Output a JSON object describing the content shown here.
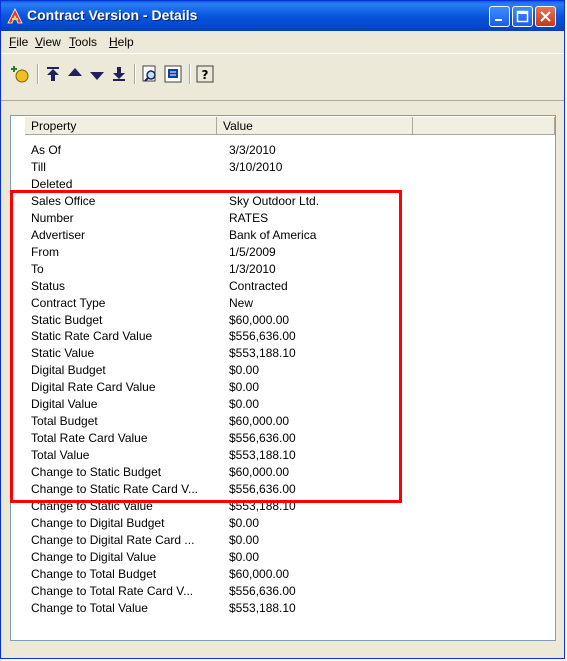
{
  "window": {
    "title": "Contract Version - Details",
    "menu": [
      "File",
      "View",
      "Tools",
      "Help"
    ],
    "menu_underlines": [
      "F",
      "V",
      "T",
      "H"
    ]
  },
  "toolbar": {
    "icons": [
      "new-record-icon",
      "move-top-icon",
      "move-up-icon",
      "move-down-icon",
      "move-bottom-icon",
      "find-icon",
      "report-icon",
      "help-icon"
    ]
  },
  "table": {
    "headers": [
      "Property",
      "Value"
    ],
    "rows": [
      [
        "As Of",
        "3/3/2010"
      ],
      [
        "Till",
        "3/10/2010"
      ],
      [
        "Deleted",
        ""
      ],
      [
        "Sales Office",
        "Sky Outdoor Ltd."
      ],
      [
        "Number",
        "RATES"
      ],
      [
        "Advertiser",
        "Bank of America"
      ],
      [
        "From",
        "1/5/2009"
      ],
      [
        "To",
        "1/3/2010"
      ],
      [
        "Status",
        "Contracted"
      ],
      [
        "Contract Type",
        "New"
      ],
      [
        "Static Budget",
        "$60,000.00"
      ],
      [
        "Static Rate Card Value",
        "$556,636.00"
      ],
      [
        "Static Value",
        "$553,188.10"
      ],
      [
        "Digital Budget",
        "$0.00"
      ],
      [
        "Digital Rate Card Value",
        "$0.00"
      ],
      [
        "Digital Value",
        "$0.00"
      ],
      [
        "Total Budget",
        "$60,000.00"
      ],
      [
        "Total Rate Card Value",
        "$556,636.00"
      ],
      [
        "Total Value",
        "$553,188.10"
      ],
      [
        "Change to Static Budget",
        "$60,000.00"
      ],
      [
        "Change to Static Rate Card V...",
        "$556,636.00"
      ],
      [
        "Change to Static Value",
        "$553,188.10"
      ],
      [
        "Change to Digital Budget",
        "$0.00"
      ],
      [
        "Change to Digital Rate Card ...",
        "$0.00"
      ],
      [
        "Change to Digital Value",
        "$0.00"
      ],
      [
        "Change to Total Budget",
        "$60,000.00"
      ],
      [
        "Change to Total Rate Card V...",
        "$556,636.00"
      ],
      [
        "Change to Total Value",
        "$553,188.10"
      ]
    ]
  },
  "colors": {
    "title_bar": "#0855dd",
    "highlight_box": "#ff0000"
  }
}
